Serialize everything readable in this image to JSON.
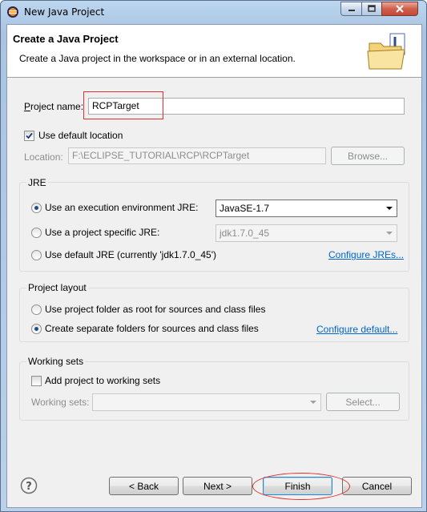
{
  "window": {
    "title": "New Java Project",
    "icon": "eclipse-icon"
  },
  "banner": {
    "title": "Create a Java Project",
    "description": "Create a Java project in the workspace or in an external location.",
    "icon": "java-project-folder-icon"
  },
  "project": {
    "name_label": "Project name:",
    "name_value": "RCPTarget",
    "use_default_label": "Use default location",
    "use_default_checked": true,
    "location_label": "Location:",
    "location_value": "F:\\ECLIPSE_TUTORIAL\\RCP\\RCPTarget",
    "browse_label": "Browse..."
  },
  "jre": {
    "group_title": "JRE",
    "option_env_label": "Use an execution environment JRE:",
    "option_env_value": "JavaSE-1.7",
    "option_specific_label": "Use a project specific JRE:",
    "option_specific_value": "jdk1.7.0_45",
    "option_default_label": "Use default JRE (currently 'jdk1.7.0_45')",
    "configure_link": "Configure JREs...",
    "selected": "execution-environment"
  },
  "layout": {
    "group_title": "Project layout",
    "option_root_label": "Use project folder as root for sources and class files",
    "option_separate_label": "Create separate folders for sources and class files",
    "configure_link": "Configure default...",
    "selected": "separate-folders"
  },
  "working_sets": {
    "group_title": "Working sets",
    "add_label": "Add project to working sets",
    "add_checked": false,
    "sets_label": "Working sets:",
    "sets_value": "",
    "select_label": "Select..."
  },
  "footer": {
    "back_label": "< Back",
    "next_label": "Next >",
    "finish_label": "Finish",
    "cancel_label": "Cancel"
  },
  "colors": {
    "highlight": "#e03030",
    "link": "#0066cc"
  }
}
